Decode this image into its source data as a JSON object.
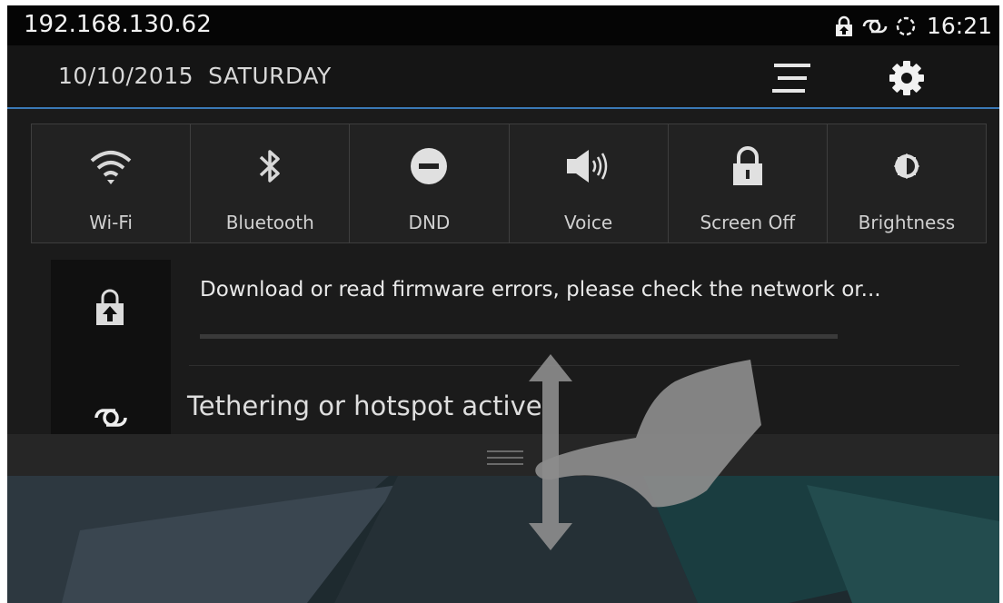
{
  "status_bar": {
    "ip_address": "192.168.130.62",
    "time": "16:21",
    "icons": [
      "lock-upload-icon",
      "tethering-icon",
      "sync-icon"
    ]
  },
  "header": {
    "date": "10/10/2015",
    "day": "SATURDAY",
    "icons": [
      "menu-icon",
      "gear-icon"
    ]
  },
  "quick_settings": [
    {
      "label": "Wi-Fi",
      "icon": "wifi-icon"
    },
    {
      "label": "Bluetooth",
      "icon": "bluetooth-icon"
    },
    {
      "label": "DND",
      "icon": "dnd-icon"
    },
    {
      "label": "Voice",
      "icon": "speaker-icon"
    },
    {
      "label": "Screen Off",
      "icon": "lock-icon"
    },
    {
      "label": "Brightness",
      "icon": "brightness-icon"
    }
  ],
  "notifications": [
    {
      "text": "Download or read firmware errors, please check the network or...",
      "icon": "lock-upload-icon",
      "progress": 0.0
    },
    {
      "text": "Tethering or hotspot active",
      "icon": "tethering-icon"
    }
  ],
  "colors": {
    "accent_line": "#3a78b5",
    "panel_bg": "#1b1b1b",
    "status_bg": "#050505"
  }
}
